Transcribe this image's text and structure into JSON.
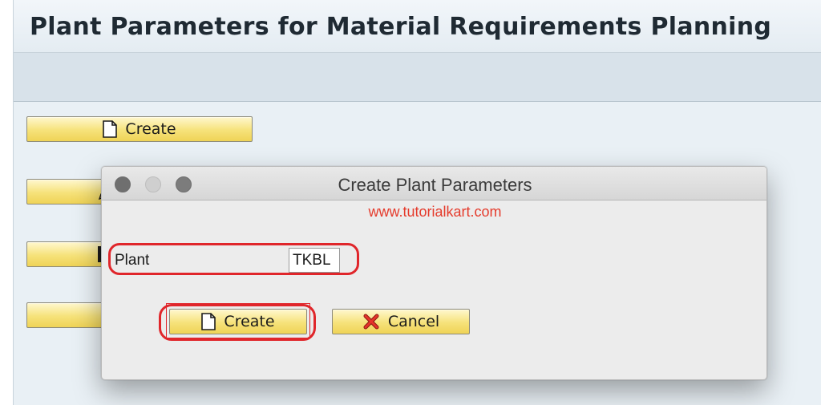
{
  "page": {
    "title": "Plant Parameters for Material Requirements Planning"
  },
  "main_buttons": [
    {
      "label": "Create",
      "icon": "document-icon"
    },
    {
      "label": "",
      "icon": "pencil-icon"
    },
    {
      "label": "",
      "icon": "document-icon"
    },
    {
      "label": "",
      "icon": ""
    }
  ],
  "dialog": {
    "title": "Create Plant Parameters",
    "watermark": "www.tutorialkart.com",
    "plant_label": "Plant",
    "plant_value": "TKBL",
    "create_label": "Create",
    "cancel_label": "Cancel",
    "create_icon": "document-icon",
    "cancel_icon": "red-x-icon"
  },
  "colors": {
    "sap_button_yellow": "#f6e27a",
    "highlight_red": "#e0262b",
    "watermark_red": "#e53b2c"
  }
}
